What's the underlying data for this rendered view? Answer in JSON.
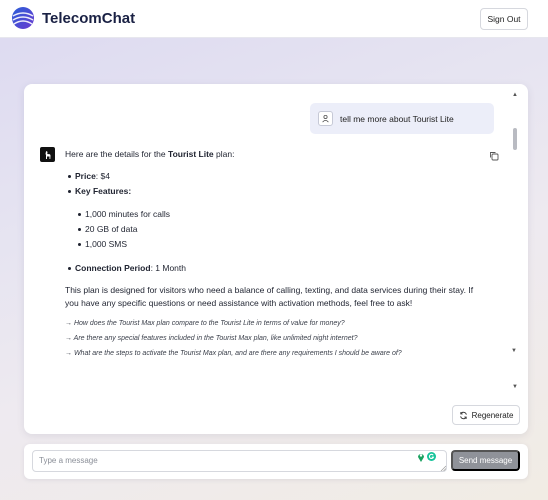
{
  "header": {
    "brand": "TelecomChat",
    "sign_out_label": "Sign Out"
  },
  "conversation": {
    "user_message": "tell me more about Tourist Lite",
    "assistant": {
      "intro_prefix": "Here are the details for the ",
      "plan_name": "Tourist Lite",
      "intro_suffix": " plan:",
      "price_label": "Price",
      "price_value": ": $4",
      "key_features_label": "Key Features",
      "key_features_suffix": ":",
      "features": [
        "1,000 minutes for calls",
        "20 GB of data",
        "1,000 SMS"
      ],
      "connection_label": "Connection Period",
      "connection_value": ": 1 Month",
      "paragraph": "This plan is designed for visitors who need a balance of calling, texting, and data services during their stay. If you have any specific questions or need assistance with activation methods, feel free to ask!",
      "suggestions": [
        "→ How does the Tourist Max plan compare to the Tourist Lite in terms of value for money?",
        "→ Are there any special features included in the Tourist Max plan, like unlimited night internet?",
        "→ What are the steps to activate the Tourist Max plan, and are there any requirements I should be aware of?"
      ]
    }
  },
  "actions": {
    "regenerate_label": "Regenerate"
  },
  "composer": {
    "placeholder": "Type a message",
    "send_label": "Send message"
  },
  "icons": {
    "logo": "globe-icon",
    "user_avatar": "user-icon",
    "bot_avatar": "llama-icon",
    "copy": "copy-icon",
    "regenerate": "refresh-icon",
    "pin": "map-pin-icon",
    "grammarly": "grammarly-icon"
  },
  "colors": {
    "brand_text": "#1a2144",
    "user_bubble": "#eceef9",
    "send_button": "#8f9299"
  }
}
